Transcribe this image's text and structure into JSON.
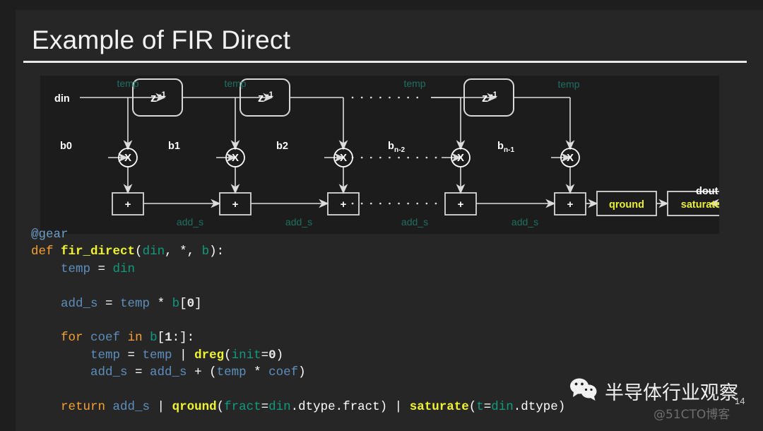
{
  "slide": {
    "title": "Example of FIR Direct",
    "page_number": "14"
  },
  "diagram": {
    "input_label": "din",
    "output_label": "dout",
    "delay_label": "z",
    "delay_exponent": "-1",
    "mult_symbol": "X",
    "add_symbol": "+",
    "signal_temp": "temp",
    "signal_add_s": "add_s",
    "coefficients": [
      "b0",
      "b1",
      "b2"
    ],
    "coef_n2_base": "b",
    "coef_n2_sub": "n-2",
    "coef_n1_base": "b",
    "coef_n1_sub": "n-1",
    "qround_label": "qround",
    "saturate_label": "saturate",
    "colors": {
      "panel_bg": "#1c1c1c",
      "wire": "#d8d8d8",
      "signal_text": "#1f6f63",
      "highlight_text": "#e9ef32"
    }
  },
  "code": {
    "lines": [
      [
        {
          "t": "@gear",
          "c": "dec"
        }
      ],
      [
        {
          "t": "def ",
          "c": "k"
        },
        {
          "t": "fir_direct",
          "c": "fn"
        },
        {
          "t": "(",
          "c": "pn"
        },
        {
          "t": "din",
          "c": "tl"
        },
        {
          "t": ", ",
          "c": "pn"
        },
        {
          "t": "*",
          "c": "pn"
        },
        {
          "t": ", ",
          "c": "pn"
        },
        {
          "t": "b",
          "c": "tl"
        },
        {
          "t": "):",
          "c": "pn"
        }
      ],
      [
        {
          "t": "    ",
          "c": "pn"
        },
        {
          "t": "temp",
          "c": "var"
        },
        {
          "t": " = ",
          "c": "pn"
        },
        {
          "t": "din",
          "c": "tl"
        }
      ],
      [],
      [
        {
          "t": "    ",
          "c": "pn"
        },
        {
          "t": "add_s",
          "c": "var"
        },
        {
          "t": " = ",
          "c": "pn"
        },
        {
          "t": "temp",
          "c": "var"
        },
        {
          "t": " * ",
          "c": "pn"
        },
        {
          "t": "b",
          "c": "tl"
        },
        {
          "t": "[",
          "c": "pn"
        },
        {
          "t": "0",
          "c": "num"
        },
        {
          "t": "]",
          "c": "pn"
        }
      ],
      [],
      [
        {
          "t": "    ",
          "c": "pn"
        },
        {
          "t": "for ",
          "c": "k"
        },
        {
          "t": "coef",
          "c": "var"
        },
        {
          "t": " ",
          "c": "pn"
        },
        {
          "t": "in",
          "c": "k"
        },
        {
          "t": " ",
          "c": "pn"
        },
        {
          "t": "b",
          "c": "tl"
        },
        {
          "t": "[",
          "c": "pn"
        },
        {
          "t": "1",
          "c": "num"
        },
        {
          "t": ":]:",
          "c": "pn"
        }
      ],
      [
        {
          "t": "        ",
          "c": "pn"
        },
        {
          "t": "temp",
          "c": "var"
        },
        {
          "t": " = ",
          "c": "pn"
        },
        {
          "t": "temp",
          "c": "var"
        },
        {
          "t": " | ",
          "c": "pn"
        },
        {
          "t": "dreg",
          "c": "fn"
        },
        {
          "t": "(",
          "c": "pn"
        },
        {
          "t": "init",
          "c": "tl"
        },
        {
          "t": "=",
          "c": "pn"
        },
        {
          "t": "0",
          "c": "num"
        },
        {
          "t": ")",
          "c": "pn"
        }
      ],
      [
        {
          "t": "        ",
          "c": "pn"
        },
        {
          "t": "add_s",
          "c": "var"
        },
        {
          "t": " = ",
          "c": "pn"
        },
        {
          "t": "add_s",
          "c": "var"
        },
        {
          "t": " + (",
          "c": "pn"
        },
        {
          "t": "temp",
          "c": "var"
        },
        {
          "t": " * ",
          "c": "pn"
        },
        {
          "t": "coef",
          "c": "var"
        },
        {
          "t": ")",
          "c": "pn"
        }
      ],
      [],
      [
        {
          "t": "    ",
          "c": "pn"
        },
        {
          "t": "return ",
          "c": "k"
        },
        {
          "t": "add_s",
          "c": "var"
        },
        {
          "t": " | ",
          "c": "pn"
        },
        {
          "t": "qround",
          "c": "fn"
        },
        {
          "t": "(",
          "c": "pn"
        },
        {
          "t": "fract",
          "c": "tl"
        },
        {
          "t": "=",
          "c": "pn"
        },
        {
          "t": "din",
          "c": "tl"
        },
        {
          "t": ".dtype.fract",
          "c": "pn"
        },
        {
          "t": ") | ",
          "c": "pn"
        },
        {
          "t": "saturate",
          "c": "fn"
        },
        {
          "t": "(",
          "c": "pn"
        },
        {
          "t": "t",
          "c": "tl"
        },
        {
          "t": "=",
          "c": "pn"
        },
        {
          "t": "din",
          "c": "tl"
        },
        {
          "t": ".dtype",
          "c": "pn"
        },
        {
          "t": ")",
          "c": "pn"
        }
      ]
    ]
  },
  "watermark": {
    "brand": "半导体行业观察",
    "source": "@51CTO博客",
    "icon": "wechat-icon"
  }
}
